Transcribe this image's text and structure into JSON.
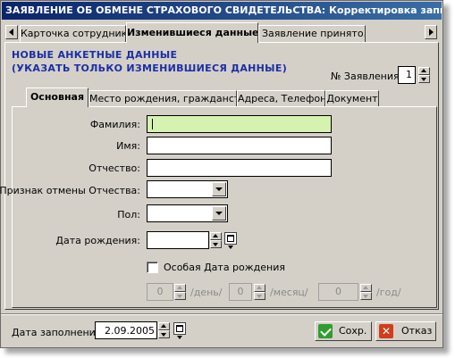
{
  "window": {
    "title": "ЗАЯВЛЕНИЕ ОБ ОБМЕНЕ СТРАХОВОГО СВИДЕТЕЛЬСТВА: Корректировка записи"
  },
  "top_tabs": {
    "tab1": "Карточка сотрудника",
    "tab2": "Изменившиеся данные",
    "tab3": "Заявление принято..."
  },
  "heading": {
    "line1": "НОВЫЕ АНКЕТНЫЕ ДАННЫЕ",
    "line2": "(УКАЗАТЬ ТОЛЬКО ИЗМЕНИВШИЕСЯ ДАННЫЕ)"
  },
  "application_number": {
    "label": "№ Заявления:",
    "value": "1"
  },
  "inner_tabs": {
    "tab1": "Основная",
    "tab2": "Место рождения, гражданство",
    "tab3": "Адреса, Телефон",
    "tab4": "Документ"
  },
  "form": {
    "surname_label": "Фамилия:",
    "surname_value": "",
    "name_label": "Имя:",
    "name_value": "",
    "patronymic_label": "Отчество:",
    "patronymic_value": "",
    "cancel_patronymic_label": "Признак отмены Отчества:",
    "gender_label": "Пол:",
    "birthdate_label": "Дата рождения:",
    "special_birthdate_label": "Особая Дата рождения",
    "day_value": "0",
    "day_label": "/день/",
    "month_value": "0",
    "month_label": "/месяц/",
    "year_value": "0",
    "year_label": "/год/"
  },
  "footer": {
    "fill_date_label": "Дата заполнения:",
    "fill_date_value": "2.09.2005",
    "save_label": "Сохр.",
    "cancel_label": "Отказ"
  },
  "colors": {
    "title_bar": "#0a246a",
    "heading_text": "#1c2ea6",
    "focused_field": "#d6f2b0",
    "save_check": "#2f9e2f",
    "cancel_x": "#d23c1e"
  }
}
